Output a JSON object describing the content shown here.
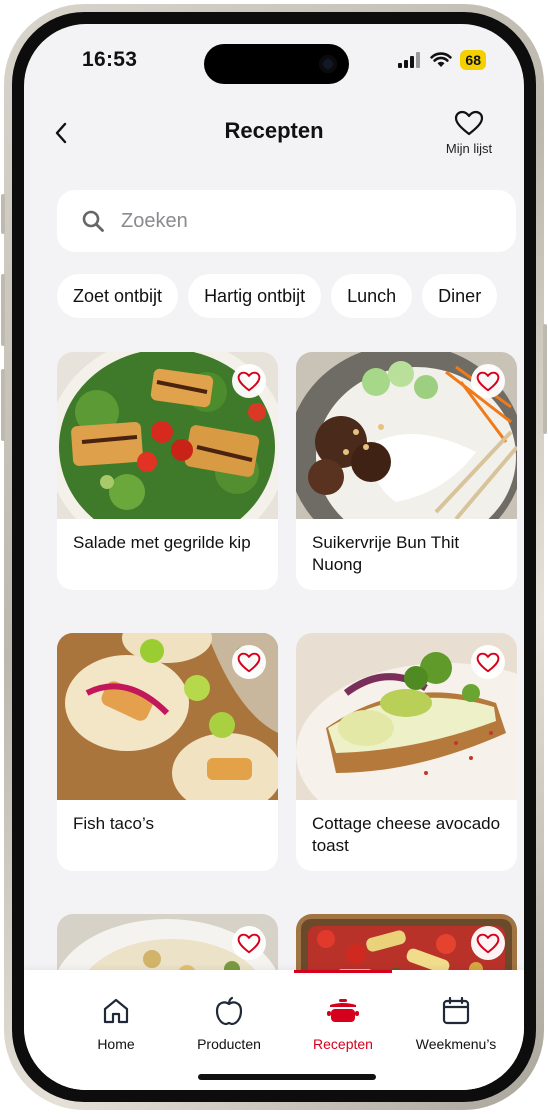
{
  "status": {
    "time": "16:53",
    "battery": "68"
  },
  "header": {
    "title": "Recepten",
    "back_icon": "chevron-left-icon",
    "mylist_label": "Mijn lijst",
    "mylist_icon": "heart-outline-icon"
  },
  "search": {
    "placeholder": "Zoeken",
    "value": "",
    "icon": "search-icon"
  },
  "categories": [
    "Zoet ontbijt",
    "Hartig ontbijt",
    "Lunch",
    "Diner"
  ],
  "recipes": [
    {
      "name": "Salade met gegrilde kip",
      "favorite_icon": "heart-outline-icon"
    },
    {
      "name": "Suikervrije Bun Thit Nuong",
      "favorite_icon": "heart-outline-icon"
    },
    {
      "name": "Fish taco’s",
      "favorite_icon": "heart-outline-icon"
    },
    {
      "name": "Cottage cheese avocado toast",
      "favorite_icon": "heart-outline-icon"
    },
    {
      "name": "",
      "favorite_icon": "heart-outline-icon"
    },
    {
      "name": "",
      "favorite_icon": "heart-outline-icon"
    }
  ],
  "tabbar": {
    "items": [
      {
        "label": "Home",
        "icon": "home-icon"
      },
      {
        "label": "Producten",
        "icon": "apple-icon"
      },
      {
        "label": "Recepten",
        "icon": "cooking-pot-icon",
        "active": true
      },
      {
        "label": "Weekmenu’s",
        "icon": "calendar-icon"
      }
    ]
  },
  "colors": {
    "accent": "#d6001c",
    "background": "#f3f3f5",
    "battery": "#f5d000"
  }
}
